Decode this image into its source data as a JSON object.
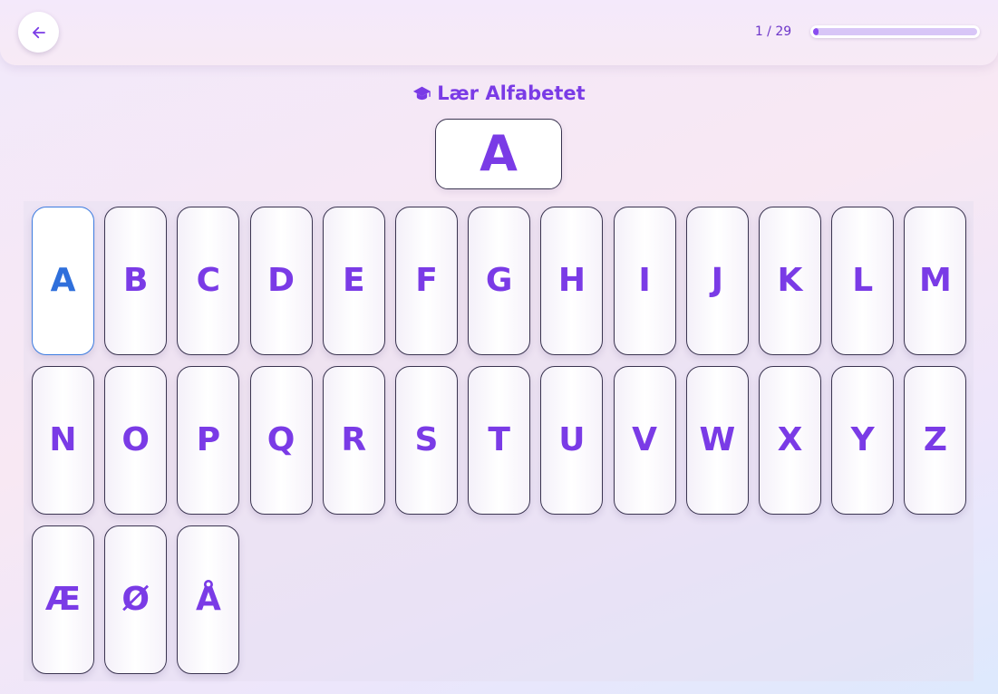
{
  "header": {
    "back_icon": "arrow-left-icon",
    "progress_text": "1 / 29",
    "progress_fraction": 0.0345,
    "accent_color": "#7a3be6"
  },
  "lesson": {
    "title": "Lær Alfabetet",
    "title_icon": "graduation-cap-icon",
    "current_letter": "A"
  },
  "alphabet": {
    "selected_index": 0,
    "letters": [
      "A",
      "B",
      "C",
      "D",
      "E",
      "F",
      "G",
      "H",
      "I",
      "J",
      "K",
      "L",
      "M",
      "N",
      "O",
      "P",
      "Q",
      "R",
      "S",
      "T",
      "U",
      "V",
      "W",
      "X",
      "Y",
      "Z",
      "Æ",
      "Ø",
      "Å"
    ]
  }
}
